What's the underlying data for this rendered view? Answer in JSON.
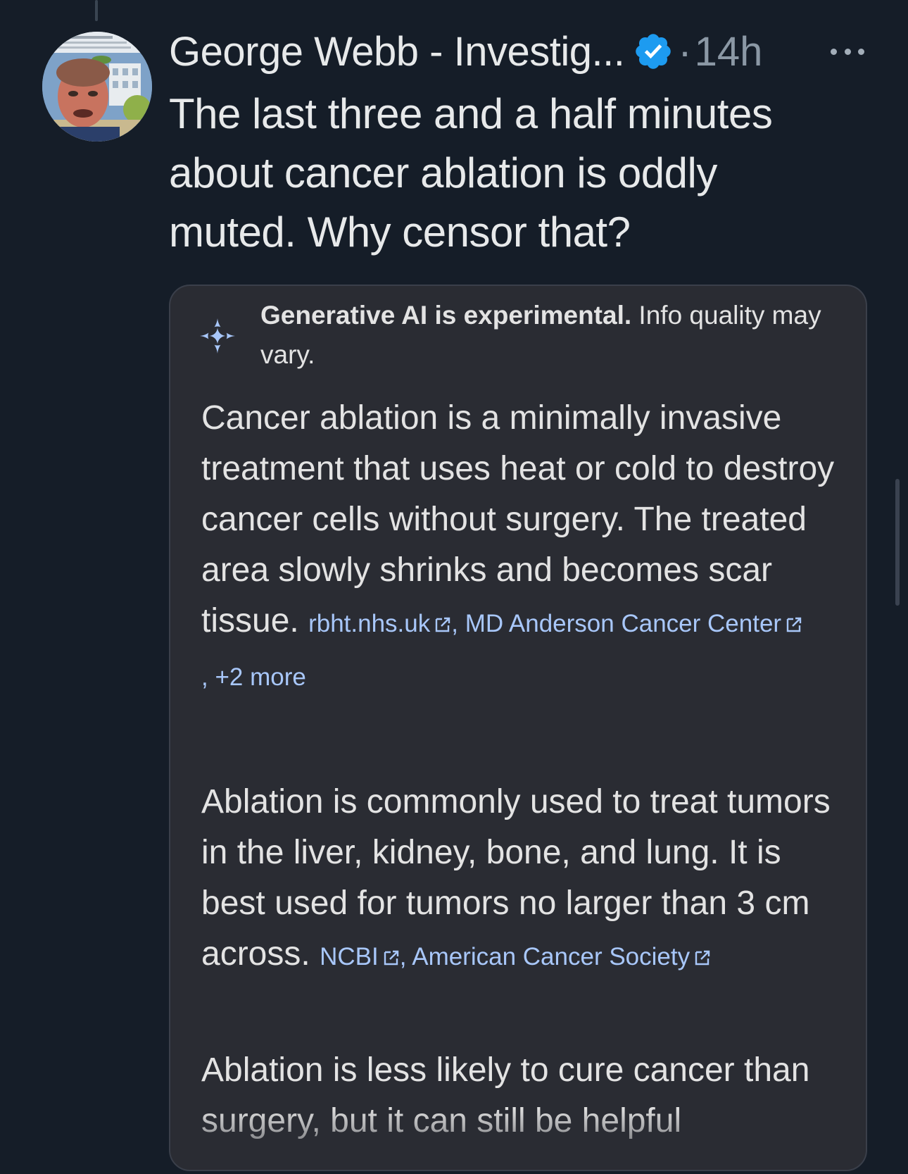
{
  "tweet": {
    "author_name": "George Webb - Investig...",
    "separator": "·",
    "timestamp": "14h",
    "text": "The last three and a half minutes\nabout cancer ablation is oddly\nmuted.  Why censor that?"
  },
  "ai_card": {
    "disclaimer_bold": "Generative AI is experimental.",
    "disclaimer_rest": " Info quality may vary.",
    "paragraphs": [
      {
        "text": "Cancer ablation is a minimally invasive treatment that uses heat or cold to destroy cancer cells without surgery. The treated area slowly shrinks and becomes scar tissue.",
        "sources": [
          "rbht.nhs.uk",
          "MD Anderson Cancer Center"
        ],
        "more": "+2 more"
      },
      {
        "text": "Ablation is commonly used to treat tumors in the liver, kidney, bone, and lung. It is best used for tumors no larger than 3 cm across.",
        "sources": [
          "NCBI",
          "American Cancer Society"
        ]
      },
      {
        "text": "Ablation is less likely to cure cancer than surgery, but it can still be helpful"
      }
    ]
  },
  "colors": {
    "background": "#151d28",
    "card_background": "#2a2c33",
    "link": "#a8c7fa",
    "verified": "#1d9bf0",
    "muted_text": "#8b98a5"
  },
  "icons": {
    "verified": "verified-badge-icon",
    "more": "more-options-icon",
    "gemini": "gemini-sparkle-icon",
    "external": "external-link-icon"
  }
}
